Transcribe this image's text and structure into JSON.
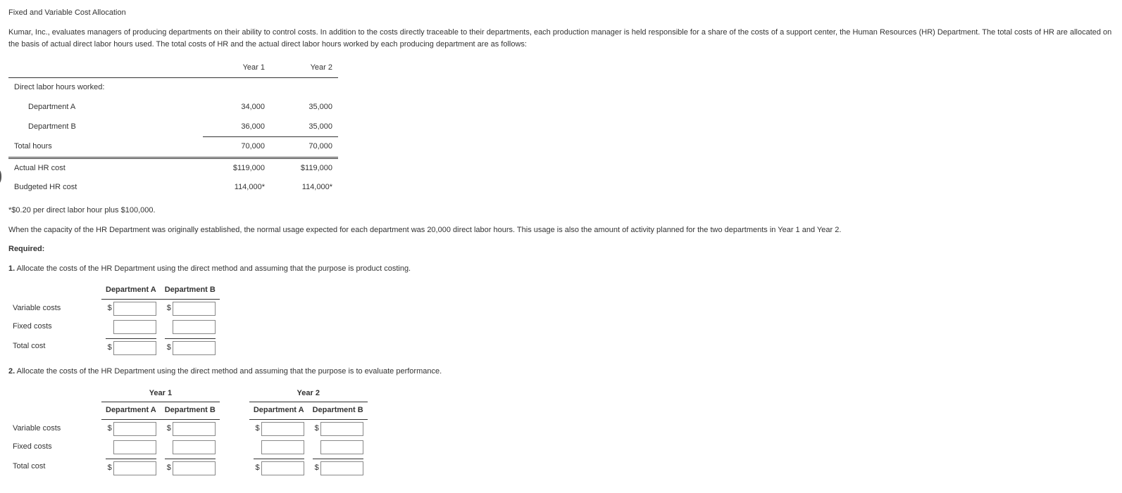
{
  "title": "Fixed and Variable Cost Allocation",
  "intro": "Kumar, Inc., evaluates managers of producing departments on their ability to control costs. In addition to the costs directly traceable to their departments, each production manager is held responsible for a share of the costs of a support center, the Human Resources (HR) Department. The total costs of HR are allocated on the basis of actual direct labor hours used. The total costs of HR and the actual direct labor hours worked by each producing department are as follows:",
  "table1": {
    "col1": "Year 1",
    "col2": "Year 2",
    "rows": {
      "dlh_header": "Direct labor hours worked:",
      "deptA": {
        "label": "Department A",
        "y1": "34,000",
        "y2": "35,000"
      },
      "deptB": {
        "label": "Department B",
        "y1": "36,000",
        "y2": "35,000"
      },
      "total": {
        "label": "Total hours",
        "y1": "70,000",
        "y2": "70,000"
      },
      "actual": {
        "label": "Actual HR cost",
        "y1": "$119,000",
        "y2": "$119,000"
      },
      "budget": {
        "label": "Budgeted HR cost",
        "y1": "114,000*",
        "y2": "114,000*"
      }
    }
  },
  "footnote": "*$0.20 per direct labor hour plus $100,000.",
  "capacity": "When the capacity of the HR Department was originally established, the normal usage expected for each department was 20,000 direct labor hours. This usage is also the amount of activity planned for the two departments in Year 1 and Year 2.",
  "required_label": "Required:",
  "q1_num": "1.",
  "q1_text": " Allocate the costs of the HR Department using the direct method and assuming that the purpose is product costing.",
  "q2_num": "2.",
  "q2_text": " Allocate the costs of the HR Department using the direct method and assuming that the purpose is to evaluate performance.",
  "ans_labels": {
    "deptA": "Department A",
    "deptB": "Department B",
    "year1": "Year 1",
    "year2": "Year 2",
    "variable": "Variable costs",
    "fixed": "Fixed costs",
    "total": "Total cost"
  },
  "dollar": "$"
}
